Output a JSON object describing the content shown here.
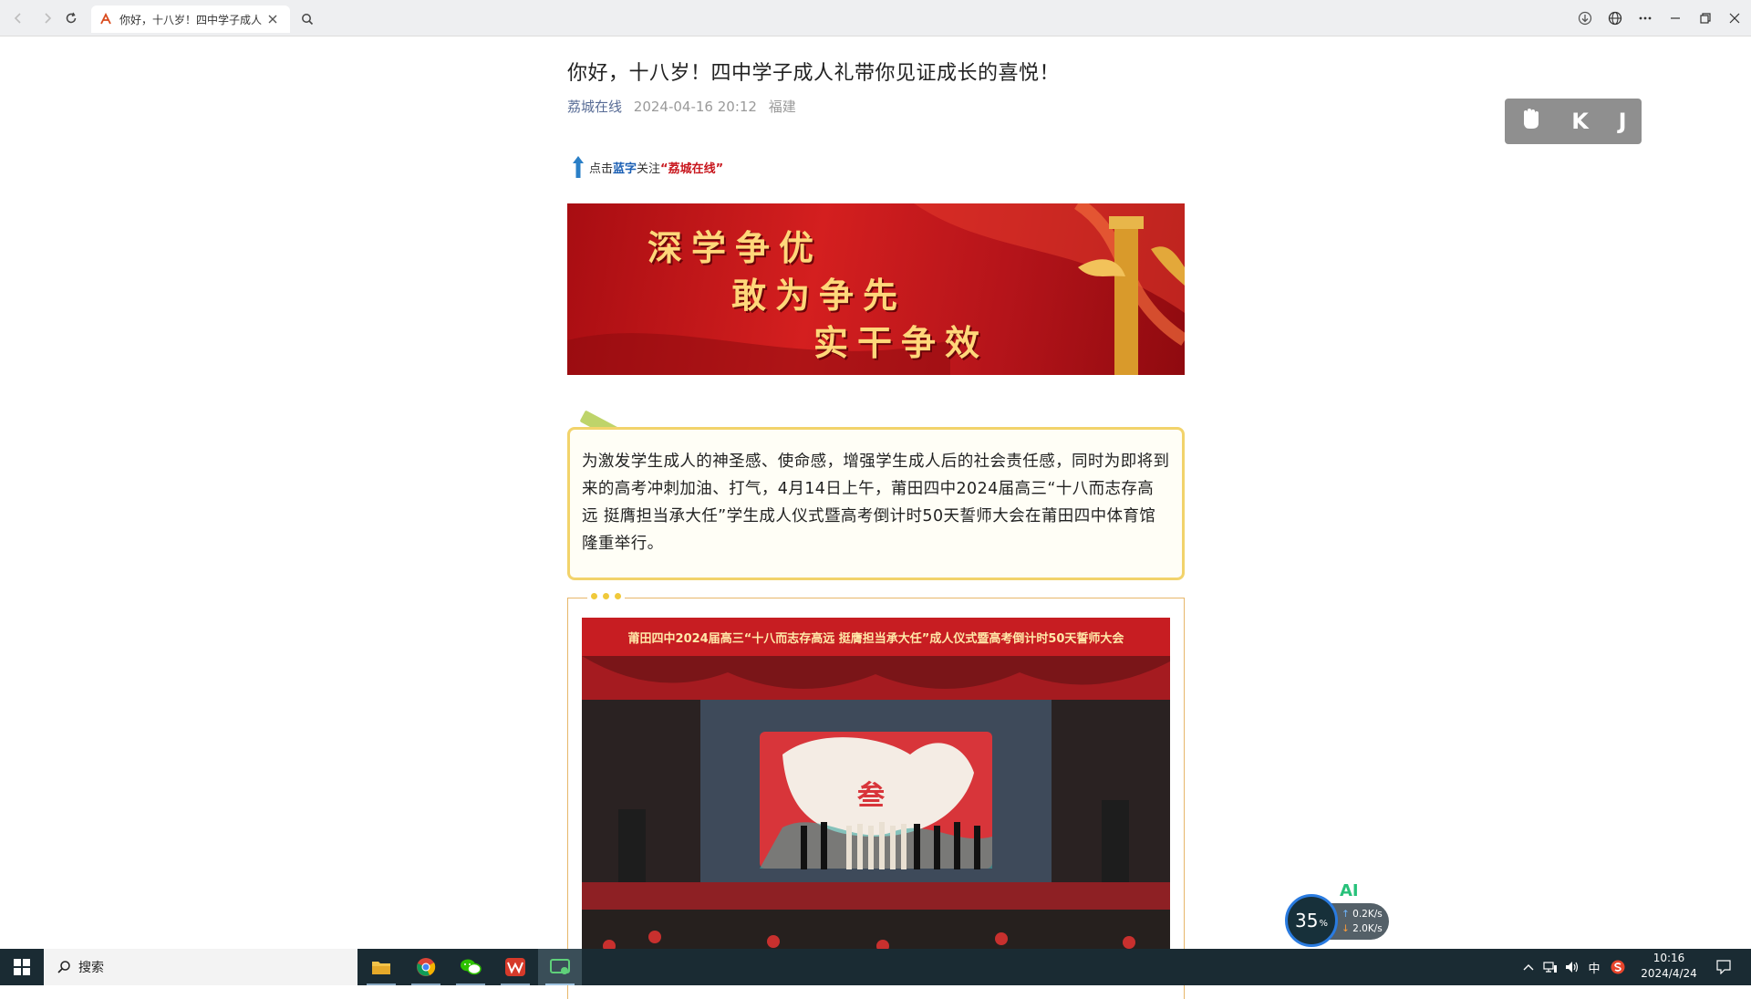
{
  "browser": {
    "tab_title": "你好，十八岁！四中学子成人礼带你见证成长的喜悦！"
  },
  "article": {
    "title": "你好，十八岁！四中学子成人礼带你见证成长的喜悦！",
    "author": "荔城在线",
    "date": "2024-04-16 20:12",
    "location": "福建",
    "follow": {
      "prefix": "点击",
      "blue_word": "蓝字",
      "middle": "关注",
      "account": "“荔城在线”"
    },
    "banner_lines": [
      "深学争优",
      "敢为争先",
      "实干争效"
    ],
    "intro": "为激发学生成人的神圣感、使命感，增强学生成人后的社会责任感，同时为即将到来的高考冲刺加油、打气，4月14日上午，莆田四中2024届高三“十八而志存高远 挺膺担当承大任”学生成人仪式暨高考倒计时50天誓师大会在莆田四中体育馆隆重举行。",
    "photo_banner": "莆田四中2024届高三“十八而志存高远  挺膺担当承大任”成人仪式暨高考倒计时50天誓师大会",
    "photo_board_char": "叁"
  },
  "float_tools": {
    "k": "K",
    "j": "J"
  },
  "performance": {
    "percent": "35",
    "percent_unit": "%",
    "upload": "0.2K/s",
    "download": "2.0K/s",
    "ai_label": "AI"
  },
  "taskbar": {
    "search_placeholder": "搜索",
    "clock_time": "10:16",
    "clock_date": "2024/4/24",
    "ime": "中"
  },
  "colors": {
    "link_blue": "#576b95",
    "accent_red": "#c8161d",
    "intro_border": "#f2d36b",
    "taskbar": "#1a2b33"
  }
}
